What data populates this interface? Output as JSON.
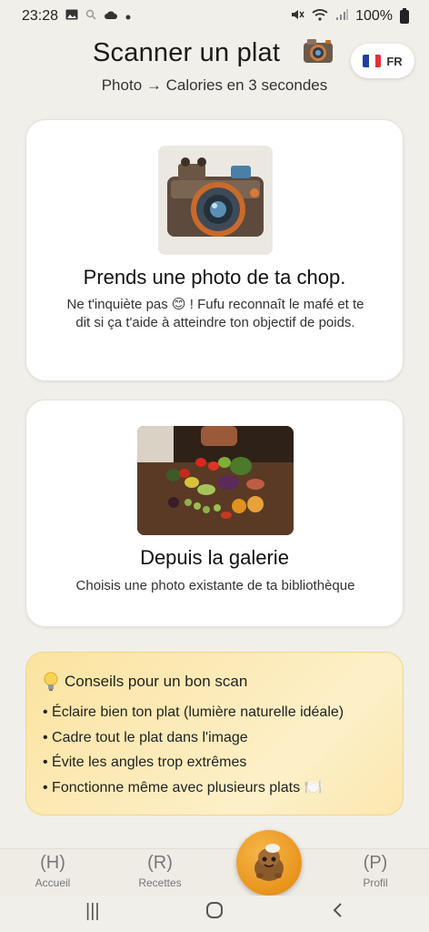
{
  "status_bar": {
    "time": "23:28",
    "battery": "100%",
    "icons_left": [
      "image-icon",
      "search-icon",
      "cloud-icon",
      "dot-icon"
    ],
    "icons_right": [
      "mute-icon",
      "wifi-icon",
      "signal-icon",
      "battery-icon"
    ]
  },
  "header": {
    "title": "Scanner un plat",
    "subtitle": "Photo → Calories en 3 secondes",
    "language": {
      "code": "FR",
      "flag": "france-flag-icon"
    }
  },
  "cards": {
    "camera": {
      "title": "Prends une photo de ta chop.",
      "description_before_emoji": "Ne t'inquiète pas ",
      "emoji": "😊",
      "description_after_emoji": " ! Fufu reconnaît le mafé et te dit si ça t'aide à atteindre ton objectif de poids."
    },
    "gallery": {
      "title": "Depuis la galerie",
      "description": "Choisis une photo existante de ta bibliothèque"
    }
  },
  "tips": {
    "title": "Conseils pour un bon scan",
    "items": [
      "Éclaire bien ton plat (lumière naturelle idéale)",
      "Cadre tout le plat dans l'image",
      "Évite les angles trop extrêmes",
      "Fonctionne même avec plusieurs plats 🍽️"
    ]
  },
  "bottom_nav": {
    "home": {
      "glyph": "(H)",
      "label": "Accueil"
    },
    "recipes": {
      "glyph": "(R)",
      "label": "Recettes"
    },
    "profile": {
      "glyph": "(P)",
      "label": "Profil"
    }
  },
  "system_nav": {
    "recents": "|||",
    "home": "○",
    "back": "<"
  },
  "colors": {
    "background": "#f1efe9",
    "card": "#ffffff",
    "tips_bg": "#fbe3a0",
    "fab": "#e8941c"
  }
}
